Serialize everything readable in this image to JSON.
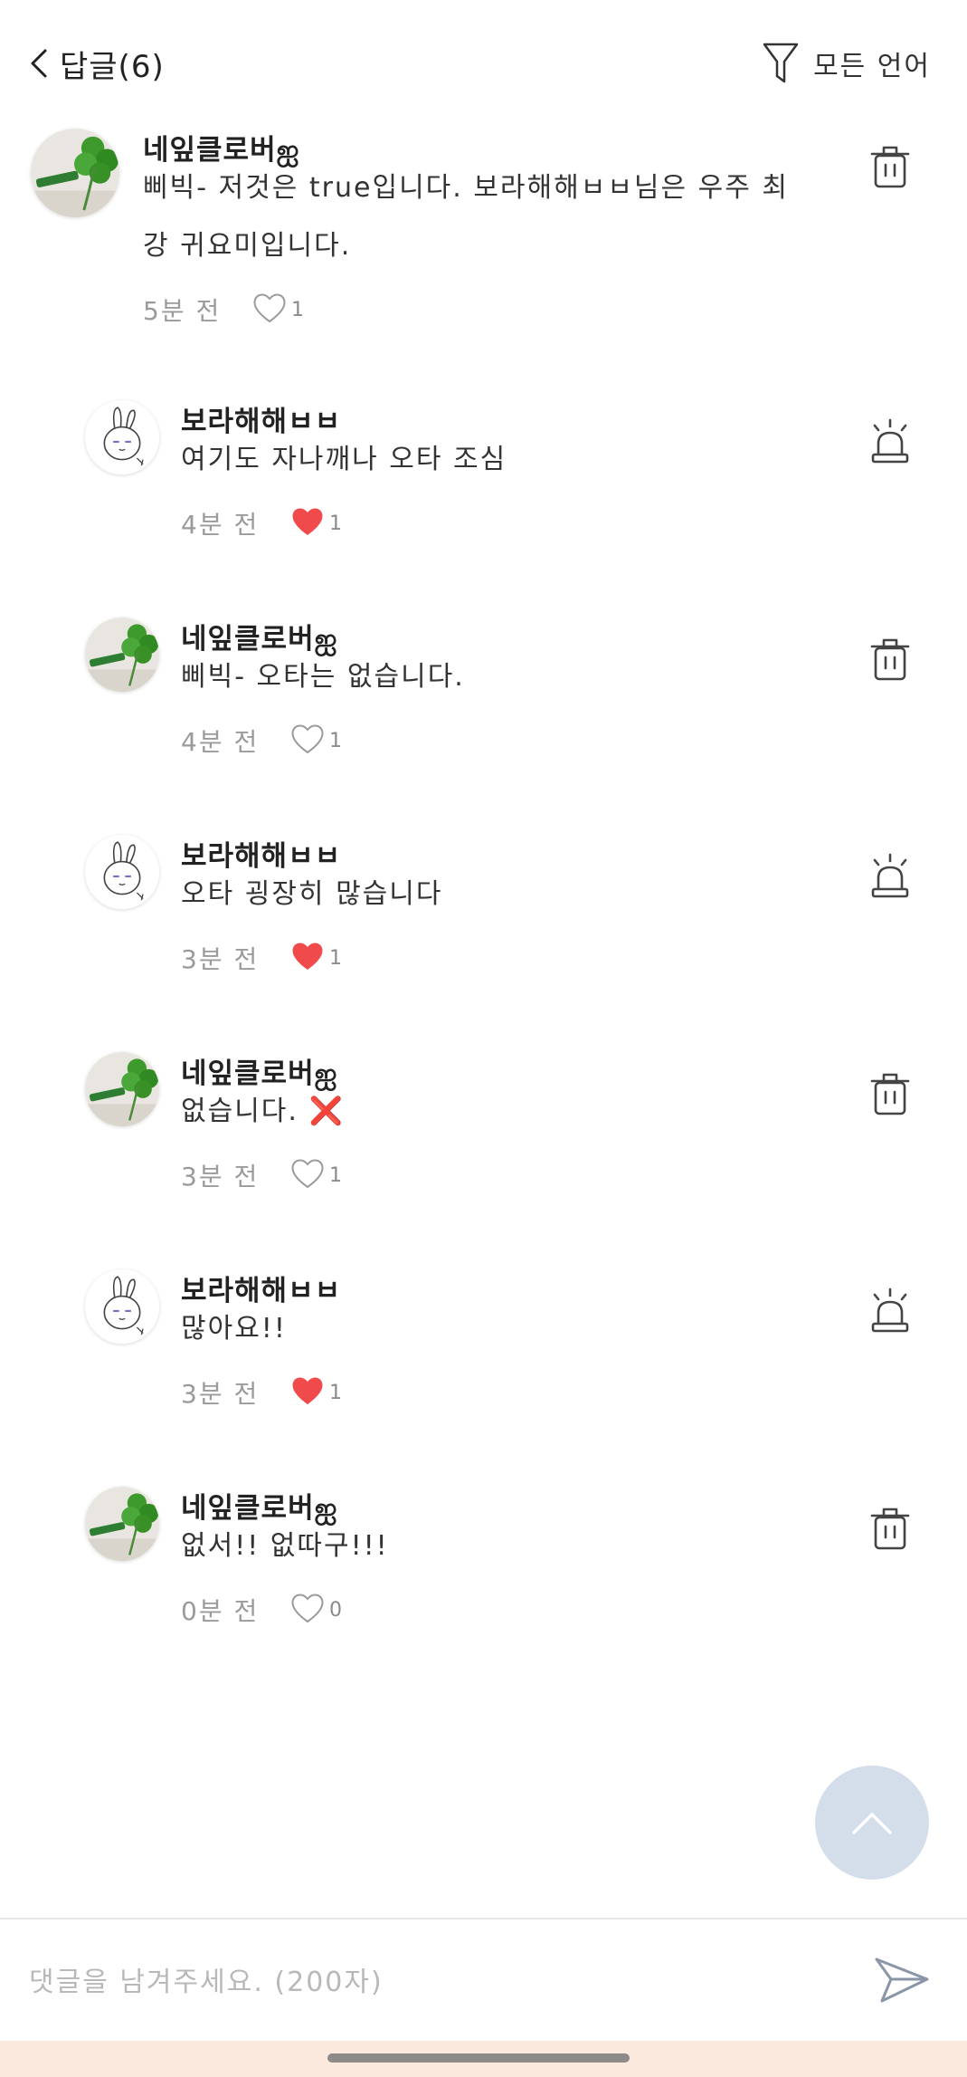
{
  "header": {
    "title": "답글(6)",
    "language_filter": "모든 언어"
  },
  "comments": [
    {
      "author": "네잎클로버ஐ",
      "text": "삐빅- 저것은 true입니다. 보라해해ㅂㅂ님은 우주 최강 귀요미입니다.",
      "time": "5분 전",
      "liked": false,
      "likes": "1",
      "action": "delete",
      "avatar": "clover"
    },
    {
      "author": "보라해해ㅂㅂ",
      "text": "여기도 자나깨나 오타 조심",
      "time": "4분 전",
      "liked": true,
      "likes": "1",
      "action": "report",
      "avatar": "bunny"
    },
    {
      "author": "네잎클로버ஐ",
      "text": "삐빅- 오타는 없습니다.",
      "time": "4분 전",
      "liked": false,
      "likes": "1",
      "action": "delete",
      "avatar": "clover"
    },
    {
      "author": "보라해해ㅂㅂ",
      "text": "오타 굉장히 많습니다",
      "time": "3분 전",
      "liked": true,
      "likes": "1",
      "action": "report",
      "avatar": "bunny"
    },
    {
      "author": "네잎클로버ஐ",
      "text": "없습니다. ❌",
      "time": "3분 전",
      "liked": false,
      "likes": "1",
      "action": "delete",
      "avatar": "clover"
    },
    {
      "author": "보라해해ㅂㅂ",
      "text": "많아요!!",
      "time": "3분 전",
      "liked": true,
      "likes": "1",
      "action": "report",
      "avatar": "bunny"
    },
    {
      "author": "네잎클로버ஐ",
      "text": "없서!! 없따구!!!",
      "time": "0분 전",
      "liked": false,
      "likes": "0",
      "action": "delete",
      "avatar": "clover"
    }
  ],
  "input": {
    "placeholder": "댓글을 남겨주세요. (200자)",
    "value": ""
  },
  "colors": {
    "heart_liked": "#f04a4a",
    "heart_outline": "#9a9a9a",
    "scroll_top_bg": "#d3deea",
    "home_bar_bg": "#fbe9dd"
  },
  "icons": {
    "back": "chevron-left-icon",
    "filter": "funnel-icon",
    "delete": "trash-icon",
    "report": "siren-icon",
    "like": "heart-icon",
    "scroll_top": "chevron-up-icon",
    "send": "paper-plane-icon"
  }
}
